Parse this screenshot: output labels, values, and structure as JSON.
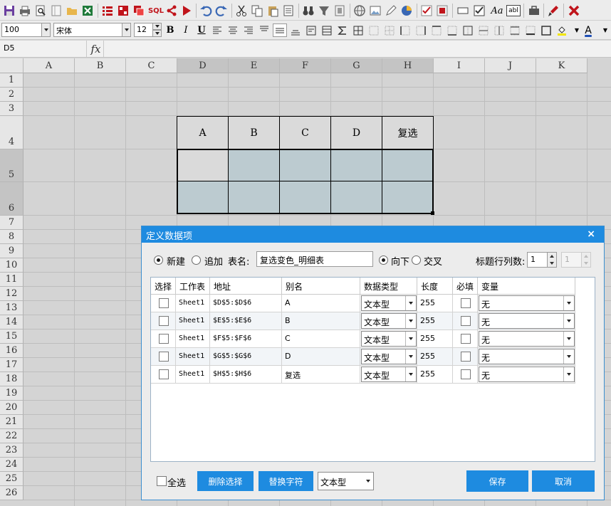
{
  "toolbar": {
    "icons": [
      "save-icon",
      "print-icon",
      "print-preview-icon",
      "page-setup-icon",
      "open-folder-icon",
      "excel-icon",
      "list-icon",
      "table-icon",
      "copy-table-icon",
      "sql-icon",
      "share-icon",
      "play-icon",
      "undo-icon",
      "redo-icon",
      "cut-icon",
      "copy-icon",
      "paste-icon",
      "binoculars-icon",
      "filter-icon",
      "sort-icon",
      "web-icon",
      "image-icon",
      "edit-icon",
      "pie-chart-icon",
      "check-icon",
      "condition-icon",
      "textbox-icon",
      "checkbox-icon",
      "aa-label-icon",
      "abl-field-icon",
      "toolbox-icon",
      "brush-icon",
      "close-red-icon"
    ],
    "sql_label": "SQL",
    "aa_label": "Aa",
    "abl_label": "abl"
  },
  "format": {
    "zoom": "100",
    "font_name": "宋体",
    "font_size": "12",
    "bold": "B",
    "italic": "I",
    "underline": "U",
    "font_color_label": "A"
  },
  "formula": {
    "cell_ref": "D5",
    "fx": "fx"
  },
  "columns": [
    "A",
    "B",
    "C",
    "D",
    "E",
    "F",
    "G",
    "H",
    "I",
    "J",
    "K"
  ],
  "rows": [
    "1",
    "2",
    "3",
    "4",
    "5",
    "6",
    "7",
    "8",
    "9",
    "10",
    "11",
    "12",
    "13",
    "14",
    "15",
    "16",
    "17",
    "18",
    "19",
    "20",
    "21",
    "22",
    "23",
    "24",
    "25",
    "26"
  ],
  "sheet_table": {
    "headers": [
      "A",
      "B",
      "C",
      "D",
      "复选"
    ]
  },
  "dialog": {
    "title": "定义数据项",
    "close": "×",
    "mode_new": "新建",
    "mode_append": "追加",
    "table_name_label": "表名:",
    "table_name": "复选变色_明细表",
    "dir_down": "向下",
    "dir_cross": "交叉",
    "title_rows_label": "标题行列数:",
    "title_rows": "1",
    "title_cols": "1",
    "columns": {
      "select": "选择",
      "sheet": "工作表",
      "address": "地址",
      "alias": "别名",
      "dtype": "数据类型",
      "length": "长度",
      "required": "必填",
      "variable": "变量"
    },
    "rows": [
      {
        "sheet": "Sheet1",
        "address": "$D$5:$D$6",
        "alias": "A",
        "dtype": "文本型",
        "length": "255",
        "variable": "无"
      },
      {
        "sheet": "Sheet1",
        "address": "$E$5:$E$6",
        "alias": "B",
        "dtype": "文本型",
        "length": "255",
        "variable": "无"
      },
      {
        "sheet": "Sheet1",
        "address": "$F$5:$F$6",
        "alias": "C",
        "dtype": "文本型",
        "length": "255",
        "variable": "无"
      },
      {
        "sheet": "Sheet1",
        "address": "$G$5:$G$6",
        "alias": "D",
        "dtype": "文本型",
        "length": "255",
        "variable": "无"
      },
      {
        "sheet": "Sheet1",
        "address": "$H$5:$H$6",
        "alias": "复选",
        "dtype": "文本型",
        "length": "255",
        "variable": "无"
      }
    ],
    "select_all": "全选",
    "delete_selected": "删除选择",
    "replace_chars": "替换字符",
    "type_select": "文本型",
    "save": "保存",
    "cancel": "取消"
  },
  "colors": {
    "accent": "#1e8be0",
    "cell_fill": "#bccbd0",
    "selected_header": "#c4c4c4"
  }
}
